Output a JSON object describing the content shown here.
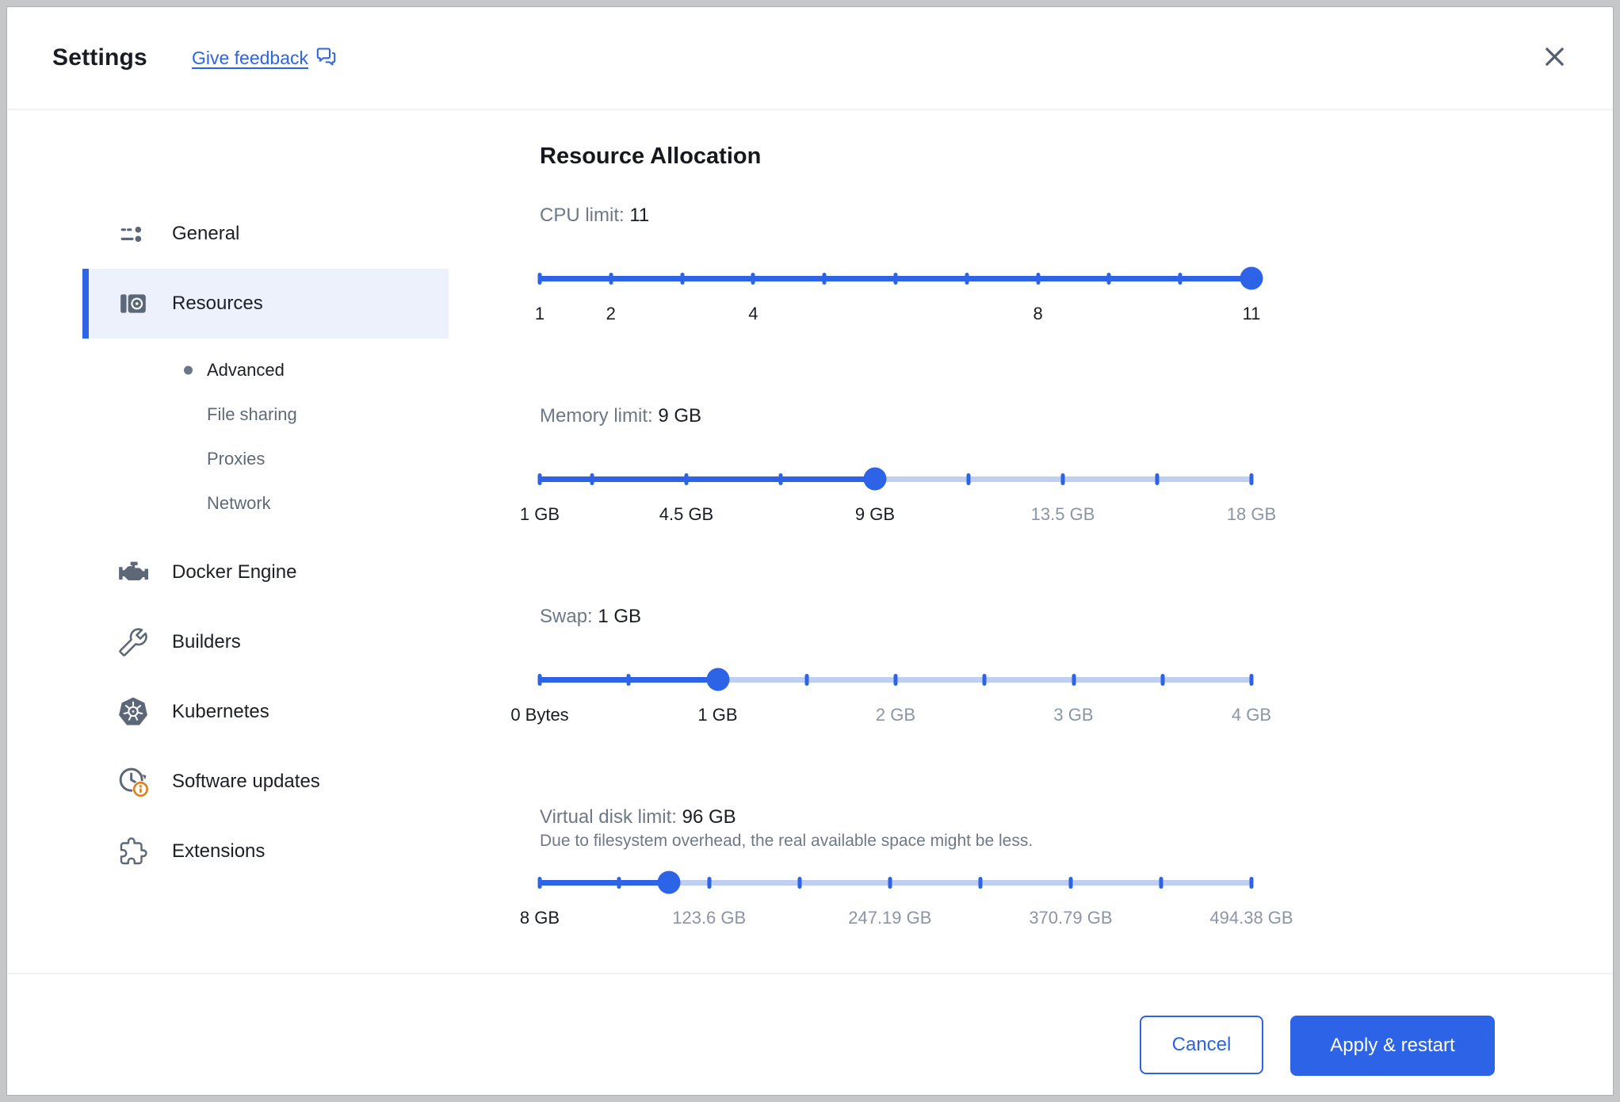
{
  "window": {
    "title": "Settings",
    "feedback_label": "Give feedback",
    "close_icon": "close-icon"
  },
  "colors": {
    "accent": "#2d63e6",
    "track_unfilled": "#bfcff2",
    "selected_row_bg": "#edf1fc",
    "badge_orange": "#dd7e1f"
  },
  "sidebar": {
    "items": [
      {
        "id": "general",
        "type": "item",
        "label": "General",
        "icon": "tune-icon",
        "selected": false
      },
      {
        "id": "resources",
        "type": "item",
        "label": "Resources",
        "icon": "resources-icon",
        "selected": true
      },
      {
        "id": "advanced",
        "type": "subitem",
        "label": "Advanced",
        "active": true
      },
      {
        "id": "file-sharing",
        "type": "subitem",
        "label": "File sharing",
        "active": false
      },
      {
        "id": "proxies",
        "type": "subitem",
        "label": "Proxies",
        "active": false
      },
      {
        "id": "network",
        "type": "subitem",
        "label": "Network",
        "active": false
      },
      {
        "id": "docker-engine",
        "type": "item",
        "label": "Docker Engine",
        "icon": "engine-icon",
        "selected": false
      },
      {
        "id": "builders",
        "type": "item",
        "label": "Builders",
        "icon": "wrench-icon",
        "selected": false
      },
      {
        "id": "kubernetes",
        "type": "item",
        "label": "Kubernetes",
        "icon": "kubernetes-icon",
        "selected": false
      },
      {
        "id": "software-updates",
        "type": "item",
        "label": "Software updates",
        "icon": "clock-update-icon",
        "badge": "info",
        "selected": false
      },
      {
        "id": "extensions",
        "type": "item",
        "label": "Extensions",
        "icon": "puzzle-icon",
        "selected": false
      }
    ]
  },
  "main": {
    "title": "Resource Allocation"
  },
  "resource": {
    "sliders": [
      {
        "id": "cpu",
        "label": "CPU limit:",
        "value": "11",
        "fill_pct": 100,
        "ticks_pct": [
          0,
          10,
          20,
          30,
          40,
          50,
          60,
          70,
          80,
          90,
          100
        ],
        "axis": [
          {
            "text": "1",
            "pct": 0,
            "muted": false
          },
          {
            "text": "2",
            "pct": 10,
            "muted": false
          },
          {
            "text": "4",
            "pct": 30,
            "muted": false
          },
          {
            "text": "8",
            "pct": 70,
            "muted": false
          },
          {
            "text": "11",
            "pct": 100,
            "muted": false
          }
        ]
      },
      {
        "id": "memory",
        "label": "Memory limit:",
        "value": "9 GB",
        "fill_pct": 47.1,
        "ticks_pct": [
          0,
          7.4,
          20.6,
          33.8,
          47.1,
          60.3,
          73.5,
          86.8,
          100
        ],
        "axis": [
          {
            "text": "1 GB",
            "pct": 0,
            "muted": false
          },
          {
            "text": "4.5 GB",
            "pct": 20.6,
            "muted": false
          },
          {
            "text": "9 GB",
            "pct": 47.1,
            "muted": false
          },
          {
            "text": "13.5 GB",
            "pct": 73.5,
            "muted": true
          },
          {
            "text": "18 GB",
            "pct": 100,
            "muted": true
          }
        ]
      },
      {
        "id": "swap",
        "label": "Swap:",
        "value": "1 GB",
        "fill_pct": 25,
        "ticks_pct": [
          0,
          12.5,
          25,
          37.5,
          50,
          62.5,
          75,
          87.5,
          100
        ],
        "axis": [
          {
            "text": "0 Bytes",
            "pct": 0,
            "muted": false
          },
          {
            "text": "1 GB",
            "pct": 25,
            "muted": false
          },
          {
            "text": "2 GB",
            "pct": 50,
            "muted": true
          },
          {
            "text": "3 GB",
            "pct": 75,
            "muted": true
          },
          {
            "text": "4 GB",
            "pct": 100,
            "muted": true
          }
        ]
      },
      {
        "id": "disk",
        "label": "Virtual disk limit:",
        "value": "96 GB",
        "note": "Due to filesystem overhead, the real available space might be less.",
        "fill_pct": 18.1,
        "ticks_pct": [
          0,
          11.1,
          23.8,
          36.5,
          49.2,
          61.9,
          74.6,
          87.3,
          100
        ],
        "axis": [
          {
            "text": "8 GB",
            "pct": 0,
            "muted": false
          },
          {
            "text": "123.6 GB",
            "pct": 23.8,
            "muted": true
          },
          {
            "text": "247.19 GB",
            "pct": 49.2,
            "muted": true
          },
          {
            "text": "370.79 GB",
            "pct": 74.6,
            "muted": true
          },
          {
            "text": "494.38 GB",
            "pct": 100,
            "muted": true
          }
        ]
      }
    ]
  },
  "footer": {
    "cancel_label": "Cancel",
    "apply_label": "Apply & restart"
  }
}
